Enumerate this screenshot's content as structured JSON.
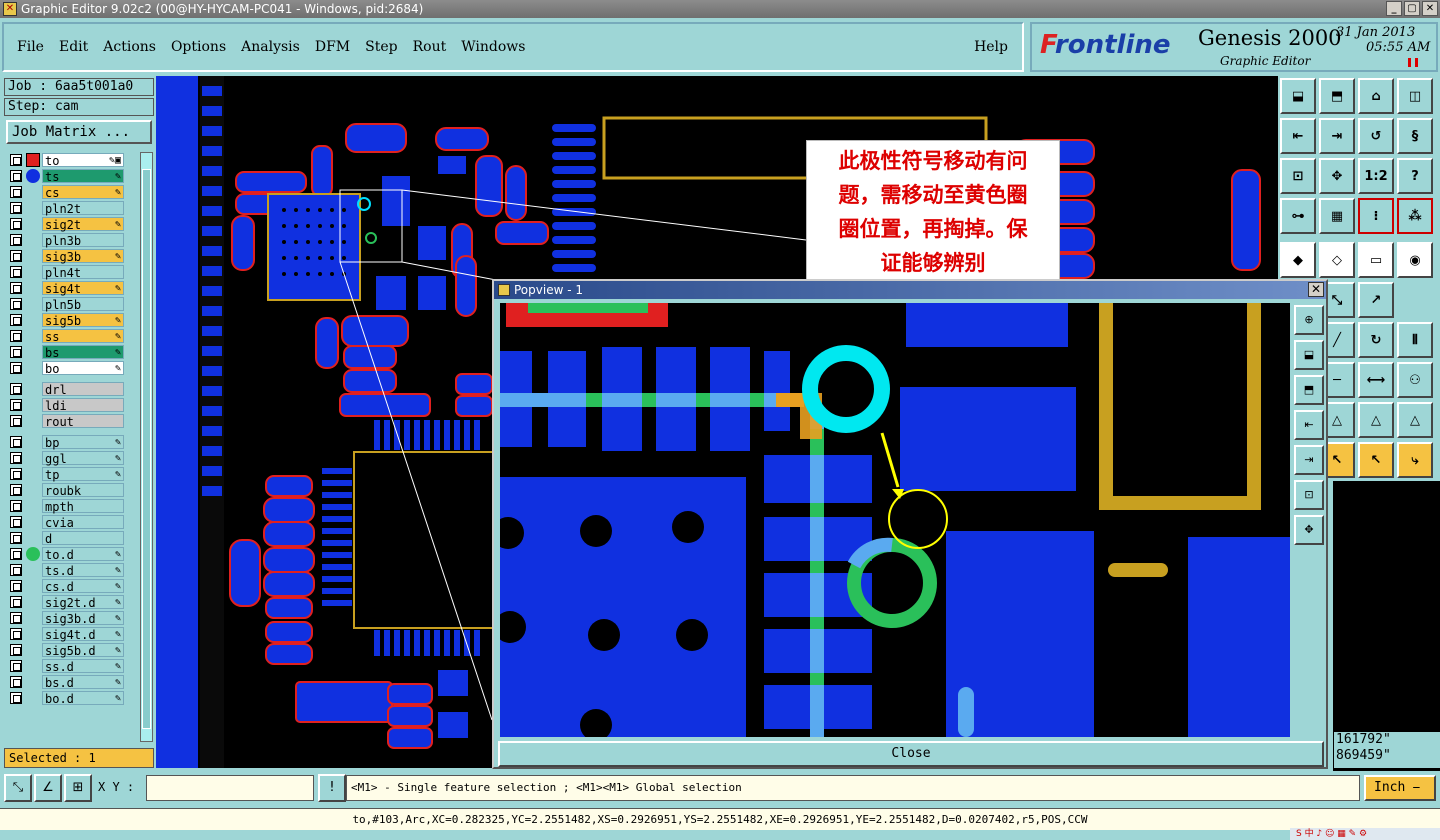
{
  "window": {
    "title": "Graphic Editor 9.02c2 (00@HY-HYCAM-PC041 - Windows, pid:2684)"
  },
  "menu": [
    "File",
    "Edit",
    "Actions",
    "Options",
    "Analysis",
    "DFM",
    "Step",
    "Rout",
    "Windows"
  ],
  "help_label": "Help",
  "brand": {
    "logo_prefix": "F",
    "logo_rest": "rontline",
    "product": "Genesis 2000",
    "subtitle": "Graphic Editor",
    "date": "31 Jan 2013",
    "time": "05:55 AM"
  },
  "job": "Job : 6aa5t001a0",
  "step": "Step: cam",
  "job_matrix": "Job Matrix ...",
  "layers": [
    {
      "name": "to",
      "color": "#ffffff",
      "marker": "red",
      "icons": "✎▣"
    },
    {
      "name": "ts",
      "color": "#1e9a6e",
      "marker": "blue",
      "icons": "✎"
    },
    {
      "name": "cs",
      "color": "#f5c242",
      "marker": "",
      "icons": "✎"
    },
    {
      "name": "pln2t",
      "color": "#9ed6d6",
      "marker": "",
      "icons": ""
    },
    {
      "name": "sig2t",
      "color": "#f5c242",
      "marker": "",
      "icons": "✎"
    },
    {
      "name": "pln3b",
      "color": "#9ed6d6",
      "marker": "",
      "icons": ""
    },
    {
      "name": "sig3b",
      "color": "#f5c242",
      "marker": "",
      "icons": "✎"
    },
    {
      "name": "pln4t",
      "color": "#9ed6d6",
      "marker": "",
      "icons": ""
    },
    {
      "name": "sig4t",
      "color": "#f5c242",
      "marker": "",
      "icons": "✎"
    },
    {
      "name": "pln5b",
      "color": "#9ed6d6",
      "marker": "",
      "icons": ""
    },
    {
      "name": "sig5b",
      "color": "#f5c242",
      "marker": "",
      "icons": "✎"
    },
    {
      "name": "ss",
      "color": "#f5c242",
      "marker": "",
      "icons": "✎"
    },
    {
      "name": "bs",
      "color": "#1e9a6e",
      "marker": "",
      "icons": "✎"
    },
    {
      "name": "bo",
      "color": "#ffffff",
      "marker": "",
      "icons": "✎"
    },
    {
      "name": "drl",
      "color": "#c8c8c8",
      "marker": "",
      "icons": "",
      "gap": true
    },
    {
      "name": "ldi",
      "color": "#c8c8c8",
      "marker": "",
      "icons": ""
    },
    {
      "name": "rout",
      "color": "#c8c8c8",
      "marker": "",
      "icons": ""
    },
    {
      "name": "bp",
      "color": "#9ed6d6",
      "marker": "",
      "icons": "✎",
      "gap": true
    },
    {
      "name": "ggl",
      "color": "#9ed6d6",
      "marker": "",
      "icons": "✎"
    },
    {
      "name": "tp",
      "color": "#9ed6d6",
      "marker": "",
      "icons": "✎"
    },
    {
      "name": "roubk",
      "color": "#9ed6d6",
      "marker": "",
      "icons": ""
    },
    {
      "name": "mpth",
      "color": "#9ed6d6",
      "marker": "",
      "icons": ""
    },
    {
      "name": "cvia",
      "color": "#9ed6d6",
      "marker": "",
      "icons": ""
    },
    {
      "name": "d",
      "color": "#9ed6d6",
      "marker": "",
      "icons": ""
    },
    {
      "name": "to.d",
      "color": "#9ed6d6",
      "marker": "green",
      "icons": "✎"
    },
    {
      "name": "ts.d",
      "color": "#9ed6d6",
      "marker": "",
      "icons": "✎"
    },
    {
      "name": "cs.d",
      "color": "#9ed6d6",
      "marker": "",
      "icons": "✎"
    },
    {
      "name": "sig2t.d",
      "color": "#9ed6d6",
      "marker": "",
      "icons": "✎"
    },
    {
      "name": "sig3b.d",
      "color": "#9ed6d6",
      "marker": "",
      "icons": "✎"
    },
    {
      "name": "sig4t.d",
      "color": "#9ed6d6",
      "marker": "",
      "icons": "✎"
    },
    {
      "name": "sig5b.d",
      "color": "#9ed6d6",
      "marker": "",
      "icons": "✎"
    },
    {
      "name": "ss.d",
      "color": "#9ed6d6",
      "marker": "",
      "icons": "✎"
    },
    {
      "name": "bs.d",
      "color": "#9ed6d6",
      "marker": "",
      "icons": "✎"
    },
    {
      "name": "bo.d",
      "color": "#9ed6d6",
      "marker": "",
      "icons": "✎"
    }
  ],
  "selected": "Selected : 1",
  "annotation": [
    "此极性符号移动有问",
    "题，需移动至黄色圈",
    "圈位置，再掏掉。保",
    "证能够辨别"
  ],
  "popview": {
    "title": "Popview - 1",
    "close": "Close"
  },
  "coords": {
    "line1": "161792\"",
    "line2": "869459\""
  },
  "xy_label": "X Y :",
  "xy_value": "",
  "hint": "<M1> - Single feature selection ; <M1><M1> Global selection",
  "unit": "Inch ⎯",
  "status": "to,#103,Arc,XC=0.282325,YC=2.2551482,XS=0.2926951,YS=2.2551482,XE=0.2926951,YE=2.2551482,D=0.0207402,r5,POS,CCW",
  "tool_labels": {
    "scale": "1:2",
    "help": "?"
  },
  "tray": "S 中 ♪ ☺ ▦ ✎ ⚙"
}
